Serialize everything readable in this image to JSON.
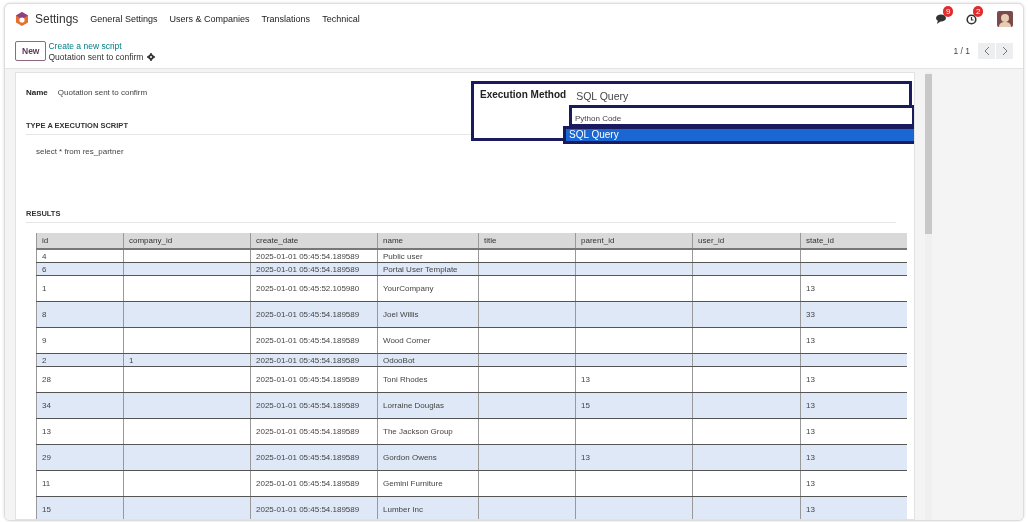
{
  "navbar": {
    "app_name": "Settings",
    "menu": [
      "General Settings",
      "Users & Companies",
      "Translations",
      "Technical"
    ],
    "messages_badge": "9",
    "activities_badge": "2"
  },
  "control_panel": {
    "new_button": "New",
    "breadcrumb": "Create a new script",
    "record_title": "Quotation sent to confirm",
    "pager": "1 / 1"
  },
  "form": {
    "name_label": "Name",
    "name_value": "Quotation sent to confirm",
    "script_heading": "TYPE A EXECUTION SCRIPT",
    "script": "select * from res_partner",
    "results_heading": "RESULTS",
    "execution_method": {
      "label": "Execution Method",
      "value": "SQL Query",
      "options": [
        {
          "label": "Python Code",
          "selected": false
        },
        {
          "label": "SQL Query",
          "selected": true
        }
      ]
    }
  },
  "table": {
    "columns": [
      "id",
      "company_id",
      "create_date",
      "name",
      "title",
      "parent_id",
      "user_id",
      "state_id"
    ],
    "rows": [
      [
        "4",
        "",
        "2025-01-01 05:45:54.189589",
        "Public user",
        "",
        "",
        "",
        ""
      ],
      [
        "6",
        "",
        "2025-01-01 05:45:54.189589",
        "Portal User Template",
        "",
        "",
        "",
        ""
      ],
      [
        "1",
        "",
        "2025-01-01 05:45:52.105980",
        "YourCompany",
        "",
        "",
        "",
        "13"
      ],
      [
        "8",
        "",
        "2025-01-01 05:45:54.189589",
        "Joel Willis",
        "",
        "",
        "",
        "33"
      ],
      [
        "9",
        "",
        "2025-01-01 05:45:54.189589",
        "Wood Corner",
        "",
        "",
        "",
        "13"
      ],
      [
        "2",
        "1",
        "2025-01-01 05:45:54.189589",
        "OdooBot",
        "",
        "",
        "",
        ""
      ],
      [
        "28",
        "",
        "2025-01-01 05:45:54.189589",
        "Toni Rhodes",
        "",
        "13",
        "",
        "13"
      ],
      [
        "34",
        "",
        "2025-01-01 05:45:54.189589",
        "Lorraine Douglas",
        "",
        "15",
        "",
        "13"
      ],
      [
        "13",
        "",
        "2025-01-01 05:45:54.189589",
        "The Jackson Group",
        "",
        "",
        "",
        "13"
      ],
      [
        "29",
        "",
        "2025-01-01 05:45:54.189589",
        "Gordon Owens",
        "",
        "13",
        "",
        "13"
      ],
      [
        "11",
        "",
        "2025-01-01 05:45:54.189589",
        "Gemini Furniture",
        "",
        "",
        "",
        "13"
      ],
      [
        "15",
        "",
        "2025-01-01 05:45:54.189589",
        "Lumber Inc",
        "",
        "",
        "",
        "13"
      ]
    ]
  }
}
